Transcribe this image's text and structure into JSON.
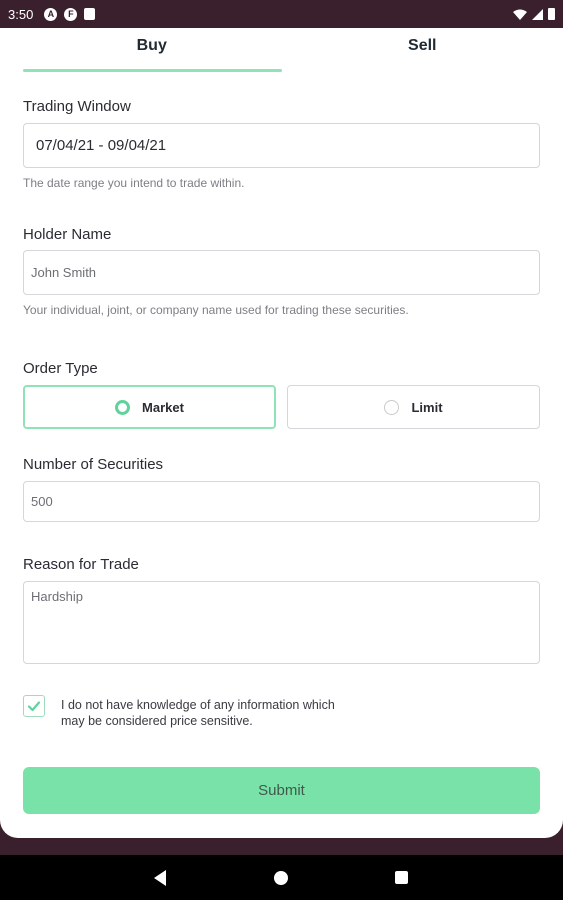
{
  "status_bar": {
    "time": "3:50",
    "icons": [
      "a-icon",
      "f-icon",
      "sim-icon"
    ],
    "right_icons": [
      "wifi-icon",
      "signal-icon",
      "battery-icon"
    ]
  },
  "tabs": [
    {
      "label": "Buy",
      "active": true
    },
    {
      "label": "Sell",
      "active": false
    }
  ],
  "form": {
    "trading_window": {
      "label": "Trading Window",
      "value": "07/04/21 - 09/04/21",
      "hint": "The date range you intend to trade within."
    },
    "holder_name": {
      "label": "Holder Name",
      "placeholder": "John Smith",
      "hint": "Your individual, joint, or company name used for trading these securities."
    },
    "order_type": {
      "label": "Order Type",
      "options": [
        {
          "label": "Market",
          "selected": true
        },
        {
          "label": "Limit",
          "selected": false
        }
      ]
    },
    "number_of_securities": {
      "label": "Number of Securities",
      "placeholder": "500"
    },
    "reason_for_trade": {
      "label": "Reason for Trade",
      "placeholder": "Hardship"
    },
    "declaration": {
      "checked": true,
      "text": "I do not have knowledge of any information which may be considered price sensitive."
    },
    "submit_label": "Submit"
  },
  "colors": {
    "accent": "#79e2a9",
    "accent_border": "#8fe3b5",
    "chrome": "#3a1f2c"
  }
}
